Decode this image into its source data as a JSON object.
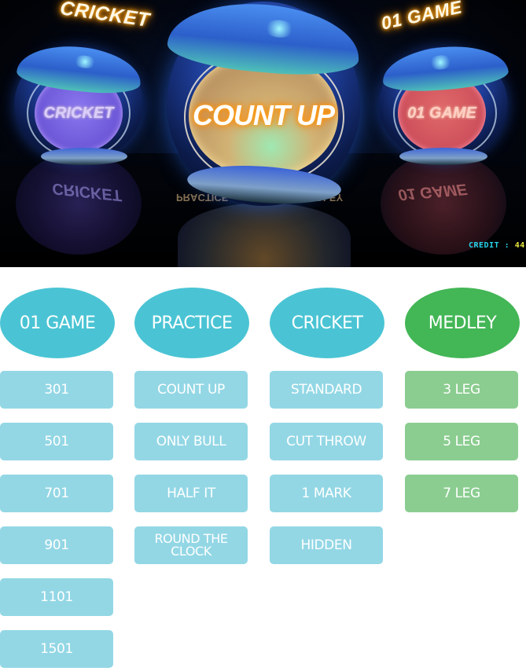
{
  "hero": {
    "floating_titles": {
      "left": "CRICKET",
      "right": "01 GAME"
    },
    "spheres": {
      "left": {
        "label": "CRICKET",
        "color": "#6a55d6"
      },
      "center": {
        "label": "COUNT UP",
        "color": "#c9a46a"
      },
      "right": {
        "label": "01 GAME",
        "color": "#cc4e5a"
      }
    },
    "reflections": {
      "practice": "PRACTICE",
      "medley": "MEDLEY",
      "left": "CRICKET",
      "right": "01 GAME"
    },
    "credit": {
      "label": "CREDIT",
      "separator": ":",
      "value": "44"
    }
  },
  "menu": {
    "colors": {
      "cyan_category": "#4ac4d4",
      "cyan_option": "#93d7e5",
      "green_category": "#43b656",
      "green_option": "#8bcd90"
    },
    "columns": [
      {
        "category": "01 GAME",
        "theme": "cyan",
        "options": [
          "301",
          "501",
          "701",
          "901",
          "1101",
          "1501"
        ]
      },
      {
        "category": "PRACTICE",
        "theme": "cyan",
        "options": [
          "COUNT UP",
          "ONLY BULL",
          "HALF IT",
          "ROUND THE CLOCK"
        ]
      },
      {
        "category": "CRICKET",
        "theme": "cyan",
        "options": [
          "STANDARD",
          "CUT THROW",
          "1 MARK",
          "HIDDEN"
        ]
      },
      {
        "category": "MEDLEY",
        "theme": "green",
        "options": [
          "3 LEG",
          "5 LEG",
          "7 LEG"
        ]
      }
    ]
  }
}
